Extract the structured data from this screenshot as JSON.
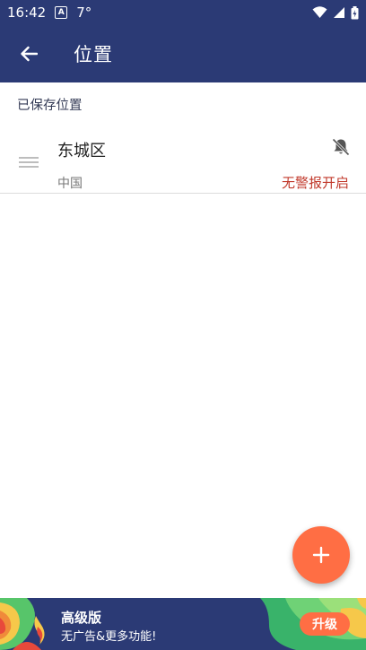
{
  "status_bar": {
    "time": "16:42",
    "notification_icon": "A",
    "temperature": "7°",
    "icons": [
      "wifi-icon",
      "signal-icon",
      "battery-icon"
    ]
  },
  "app_bar": {
    "title": "位置",
    "back_icon": "arrow-left-icon"
  },
  "section": {
    "header": "已保存位置"
  },
  "locations": [
    {
      "name": "东城区",
      "country": "中国",
      "alert_status": "无警报开启",
      "bell_icon": "bell-off-icon"
    }
  ],
  "fab": {
    "icon": "plus-icon"
  },
  "banner": {
    "title": "高级版",
    "subtitle": "无广告&更多功能!",
    "button": "升级"
  },
  "colors": {
    "primary": "#2b3a75",
    "accent": "#ff6e44",
    "alert_text": "#c1392b"
  }
}
